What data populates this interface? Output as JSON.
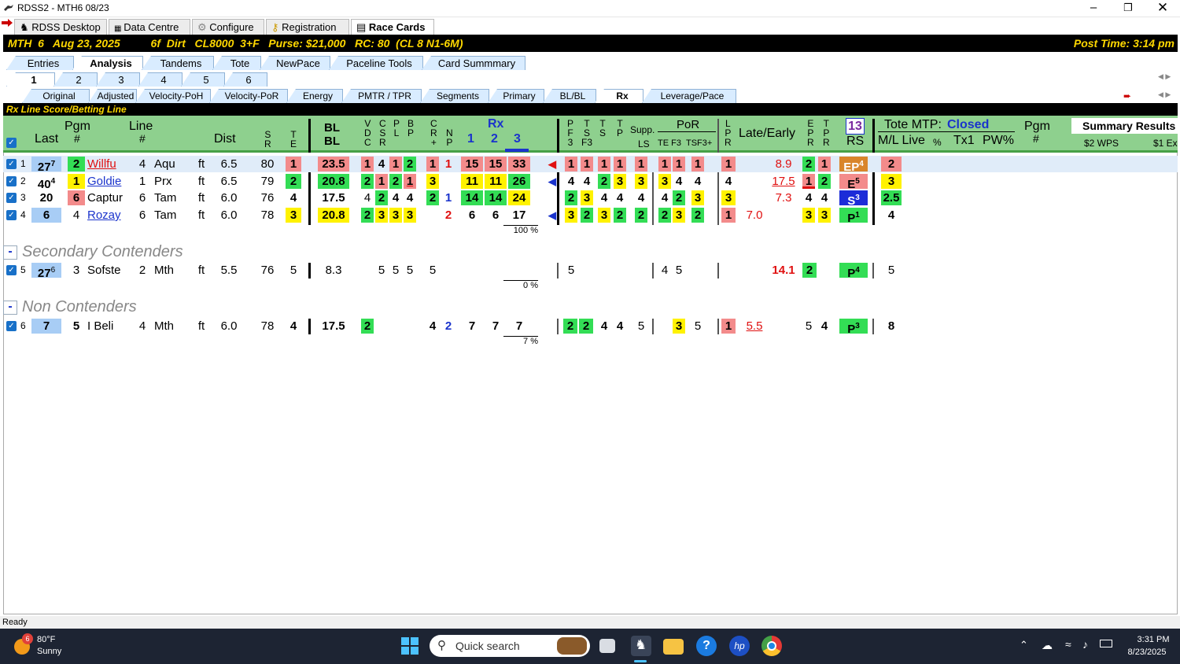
{
  "window": {
    "title": "RDSS2 - MTH6  08/23"
  },
  "main_tabs": [
    {
      "label": "RDSS Desktop"
    },
    {
      "label": "Data Centre"
    },
    {
      "label": "Configure"
    },
    {
      "label": "Registration"
    },
    {
      "label": "Race Cards"
    }
  ],
  "race": {
    "info": "MTH  6   Aug 23, 2025          6f  Dirt   CL8000  3+F   Purse: $21,000   RC: 80  (CL 8 N1-6M)",
    "post_time": "Post Time: 3:14 pm"
  },
  "sub_tabs": [
    "Entries",
    "Analysis",
    "Tandems",
    "Tote",
    "NewPace",
    "Paceline Tools",
    "Card Summmary"
  ],
  "race_tabs": [
    "1",
    "2",
    "3",
    "4",
    "5",
    "6"
  ],
  "view_tabs": [
    "Original",
    "Adjusted",
    "Velocity-PoH",
    "Velocity-PoR",
    "Energy",
    "PMTR / TPR",
    "Segments",
    "Primary",
    "BL/BL",
    "Rx",
    "Leverage/Pace"
  ],
  "rx_line_label": "Rx Line Score/Betting Line",
  "headers": {
    "last": "Last",
    "pgm": "Pgm",
    "pgm_hash": "#",
    "line": "Line",
    "line_hash": "#",
    "dist": "Dist",
    "sr": "S\nR",
    "te": "T\nE",
    "blbl": "BL\nBL",
    "vdc": "V\nD\nC",
    "csr": "C\nS\nR",
    "pl": "P\nL",
    "bp": "B\nP",
    "cr": "C\nR\n+",
    "np": "N\nP",
    "rx": "Rx",
    "rx1": "1",
    "rx2": "2",
    "rx3": "3",
    "pf3": "P\nF\n3",
    "tsf3": "T\nS\nF3",
    "ts": "T\nS",
    "tp": "T\nP",
    "supp": "Supp.",
    "ls": "LS",
    "por": "PoR",
    "te_f3": "TE F3",
    "tsf3p": "TSF3+",
    "lpr": "L\nP\nR",
    "late_early": "Late/Early",
    "epr": "E\nP\nR",
    "tpr": "T\nP\nR",
    "rs_box": "13",
    "rs": "RS",
    "tote_mtp": "Tote MTP:",
    "tote_status": "Closed",
    "ml_live": "M/L  Live",
    "pct": "%",
    "tx1": "Tx1",
    "pw": "PW%",
    "pgm2": "Pgm",
    "pgm2_hash": "#",
    "summary": "Summary Results",
    "wps": "$2 WPS",
    "ex": "$1 Ex"
  },
  "rows": [
    {
      "n": "1",
      "last": "27",
      "last_sup": "7",
      "pgm": "2",
      "name": "Willfu",
      "line": "4",
      "trk": "Aqu",
      "surf": "ft",
      "dist": "6.5",
      "sr": "80",
      "te": "1",
      "bl": "23.5",
      "v": "1",
      "c": "4",
      "p": "1",
      "b": "2",
      "cr": "1",
      "np": "1",
      "rx1": "15",
      "rx2": "15",
      "rx3": "33",
      "pf": "1",
      "ts": "1",
      "t2": "1",
      "tp": "1",
      "ls": "1",
      "por1": "1",
      "por2": "1",
      "por3": "1",
      "lpr": "1",
      "late": "",
      "early": "8.9",
      "epr": "2",
      "tpr": "1",
      "rsv": "EP",
      "rsn": "4",
      "ml": "2"
    },
    {
      "n": "2",
      "last": "40",
      "last_sup": "4",
      "pgm": "1",
      "name": "Goldie",
      "line": "1",
      "trk": "Prx",
      "surf": "ft",
      "dist": "6.5",
      "sr": "79",
      "te": "2",
      "bl": "20.8",
      "v": "2",
      "c": "1",
      "p": "2",
      "b": "1",
      "cr": "3",
      "np": "",
      "rx1": "11",
      "rx2": "11",
      "rx3": "26",
      "pf": "4",
      "ts": "4",
      "t2": "2",
      "tp": "3",
      "ls": "3",
      "por1": "3",
      "por2": "4",
      "por3": "4",
      "lpr": "4",
      "late": "",
      "early": "17.5",
      "epr": "1",
      "tpr": "2",
      "rsv": "E",
      "rsn": "5",
      "ml": "3"
    },
    {
      "n": "3",
      "last": "20",
      "last_sup": "",
      "pgm": "6",
      "name": "Captur",
      "line": "6",
      "trk": "Tam",
      "surf": "ft",
      "dist": "6.0",
      "sr": "76",
      "te": "4",
      "bl": "17.5",
      "v": "4",
      "c": "2",
      "p": "4",
      "b": "4",
      "cr": "2",
      "np": "1",
      "rx1": "14",
      "rx2": "14",
      "rx3": "24",
      "pf": "2",
      "ts": "3",
      "t2": "4",
      "tp": "4",
      "ls": "4",
      "por1": "4",
      "por2": "2",
      "por3": "3",
      "lpr": "3",
      "late": "",
      "early": "7.3",
      "epr": "4",
      "tpr": "4",
      "rsv": "S",
      "rsn": "3",
      "ml": "2.5"
    },
    {
      "n": "4",
      "last": "6",
      "last_sup": "",
      "pgm": "4",
      "name": "Rozay",
      "line": "6",
      "trk": "Tam",
      "surf": "ft",
      "dist": "6.0",
      "sr": "78",
      "te": "3",
      "bl": "20.8",
      "v": "2",
      "c": "3",
      "p": "3",
      "b": "3",
      "cr": "",
      "np": "2",
      "rx1": "6",
      "rx2": "6",
      "rx3": "17",
      "pf": "3",
      "ts": "2",
      "t2": "3",
      "tp": "2",
      "ls": "2",
      "por1": "2",
      "por2": "3",
      "por3": "2",
      "lpr": "1",
      "late": "7.0",
      "early": "",
      "epr": "3",
      "tpr": "3",
      "rsv": "P",
      "rsn": "1",
      "ml": "4"
    }
  ],
  "pct_main": "100 %",
  "section_secondary": "Secondary Contenders",
  "sec_row": {
    "n": "5",
    "last": "27",
    "last_sup": "6",
    "pgm": "3",
    "name": "Sofste",
    "line": "2",
    "trk": "Mth",
    "surf": "ft",
    "dist": "5.5",
    "sr": "76",
    "te": "5",
    "bl": "8.3",
    "c": "5",
    "p": "5",
    "b": "5",
    "cr": "5",
    "pf": "5",
    "por1": "4",
    "por2": "5",
    "early": "14.1",
    "epr": "2",
    "rsv": "P",
    "rsn": "4",
    "ml": "5",
    "pct": "0 %"
  },
  "section_non": "Non Contenders",
  "non_row": {
    "n": "6",
    "last": "7",
    "pgm": "5",
    "name": "I Beli",
    "line": "4",
    "trk": "Mth",
    "surf": "ft",
    "dist": "6.0",
    "sr": "78",
    "te": "4",
    "bl": "17.5",
    "v": "2",
    "cr": "4",
    "np": "2",
    "rx1": "7",
    "rx2": "7",
    "rx3": "7",
    "pf": "2",
    "ts": "2",
    "t2": "4",
    "tp": "4",
    "ls": "5",
    "por2": "3",
    "por3": "5",
    "lpr": "1",
    "late": "5.5",
    "epr": "5",
    "tpr": "4",
    "rsv": "P",
    "rsn": "3",
    "ml": "8",
    "pct": "7 %"
  },
  "status": "Ready",
  "taskbar": {
    "temp": "80°F",
    "weather": "Sunny",
    "badge": "6",
    "search": "Quick search",
    "time": "3:31 PM",
    "date": "8/23/2025"
  }
}
